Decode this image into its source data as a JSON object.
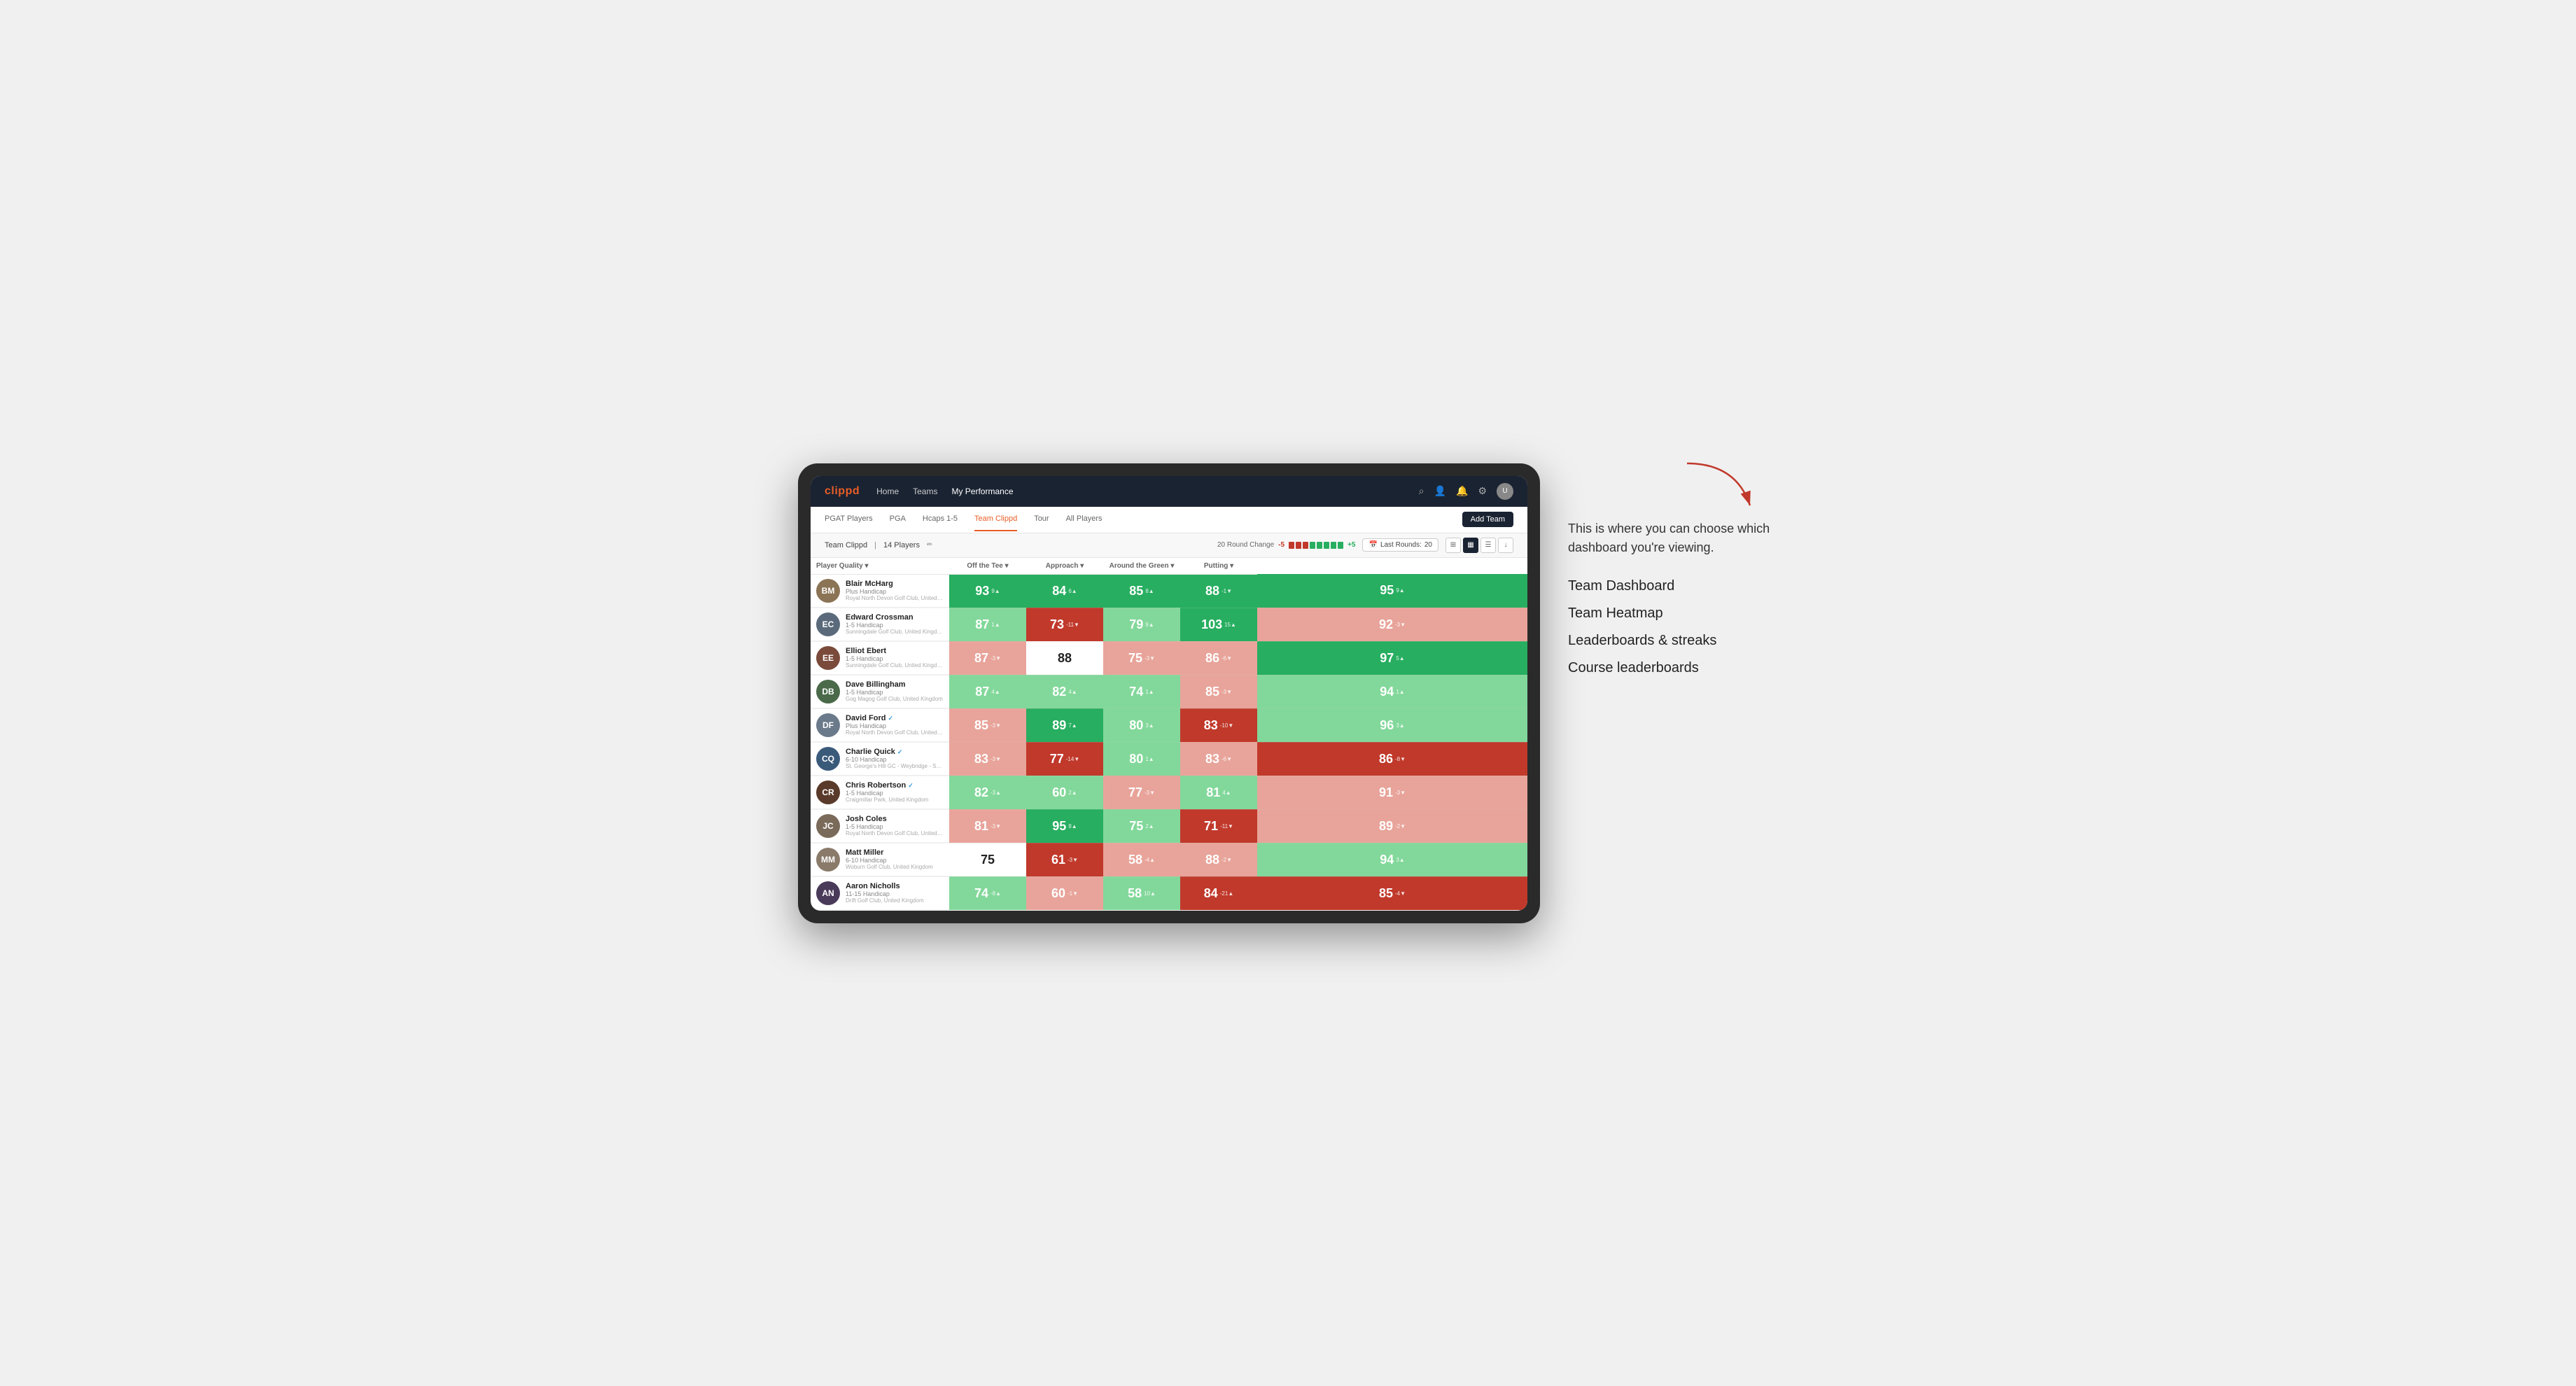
{
  "annotation": {
    "intro_text": "This is where you can choose which dashboard you're viewing.",
    "items": [
      {
        "label": "Team Dashboard"
      },
      {
        "label": "Team Heatmap"
      },
      {
        "label": "Leaderboards & streaks"
      },
      {
        "label": "Course leaderboards"
      }
    ]
  },
  "nav": {
    "logo": "clippd",
    "links": [
      "Home",
      "Teams",
      "My Performance"
    ],
    "active_link": "My Performance"
  },
  "sub_nav": {
    "links": [
      "PGAT Players",
      "PGA",
      "Hcaps 1-5",
      "Team Clippd",
      "Tour",
      "All Players"
    ],
    "active_link": "Team Clippd",
    "add_team_label": "Add Team"
  },
  "team_header": {
    "team_name": "Team Clippd",
    "player_count": "14 Players",
    "round_change_label": "20 Round Change",
    "round_change_neg": "-5",
    "round_change_pos": "+5",
    "last_rounds_label": "Last Rounds:",
    "last_rounds_value": "20"
  },
  "table": {
    "col_headers": [
      "Player Quality ▾",
      "Off the Tee ▾",
      "Approach ▾",
      "Around the Green ▾",
      "Putting ▾"
    ],
    "players": [
      {
        "name": "Blair McHarg",
        "handicap": "Plus Handicap",
        "club": "Royal North Devon Golf Club, United Kingdom",
        "avatar_color": "#8B7355",
        "initials": "BM",
        "scores": [
          {
            "value": "93",
            "change": "9▲",
            "bg": "green-dark"
          },
          {
            "value": "84",
            "change": "6▲",
            "bg": "green-dark"
          },
          {
            "value": "85",
            "change": "8▲",
            "bg": "green-dark"
          },
          {
            "value": "88",
            "change": "-1▼",
            "bg": "green-dark"
          },
          {
            "value": "95",
            "change": "9▲",
            "bg": "green-dark"
          }
        ]
      },
      {
        "name": "Edward Crossman",
        "handicap": "1-5 Handicap",
        "club": "Sunningdale Golf Club, United Kingdom",
        "avatar_color": "#5a6a7a",
        "initials": "EC",
        "scores": [
          {
            "value": "87",
            "change": "1▲",
            "bg": "green-light"
          },
          {
            "value": "73",
            "change": "-11▼",
            "bg": "red-dark"
          },
          {
            "value": "79",
            "change": "9▲",
            "bg": "green-light"
          },
          {
            "value": "103",
            "change": "15▲",
            "bg": "green-dark"
          },
          {
            "value": "92",
            "change": "-3▼",
            "bg": "red-light"
          }
        ]
      },
      {
        "name": "Elliot Ebert",
        "handicap": "1-5 Handicap",
        "club": "Sunningdale Golf Club, United Kingdom",
        "avatar_color": "#7a4a3a",
        "initials": "EE",
        "scores": [
          {
            "value": "87",
            "change": "-3▼",
            "bg": "red-light"
          },
          {
            "value": "88",
            "change": "",
            "bg": "white"
          },
          {
            "value": "75",
            "change": "-3▼",
            "bg": "red-light"
          },
          {
            "value": "86",
            "change": "-6▼",
            "bg": "red-light"
          },
          {
            "value": "97",
            "change": "5▲",
            "bg": "green-dark"
          }
        ]
      },
      {
        "name": "Dave Billingham",
        "handicap": "1-5 Handicap",
        "club": "Gog Magog Golf Club, United Kingdom",
        "avatar_color": "#4a6a4a",
        "initials": "DB",
        "scores": [
          {
            "value": "87",
            "change": "4▲",
            "bg": "green-light"
          },
          {
            "value": "82",
            "change": "4▲",
            "bg": "green-light"
          },
          {
            "value": "74",
            "change": "1▲",
            "bg": "green-light"
          },
          {
            "value": "85",
            "change": "-3▼",
            "bg": "red-light"
          },
          {
            "value": "94",
            "change": "1▲",
            "bg": "green-light"
          }
        ]
      },
      {
        "name": "David Ford",
        "handicap": "Plus Handicap",
        "club": "Royal North Devon Golf Club, United Kingdom",
        "avatar_color": "#6a7a8a",
        "initials": "DF",
        "verified": true,
        "scores": [
          {
            "value": "85",
            "change": "-3▼",
            "bg": "red-light"
          },
          {
            "value": "89",
            "change": "7▲",
            "bg": "green-dark"
          },
          {
            "value": "80",
            "change": "3▲",
            "bg": "green-light"
          },
          {
            "value": "83",
            "change": "-10▼",
            "bg": "red-dark"
          },
          {
            "value": "96",
            "change": "3▲",
            "bg": "green-light"
          }
        ]
      },
      {
        "name": "Charlie Quick",
        "handicap": "6-10 Handicap",
        "club": "St. George's Hill GC - Weybridge - Surrey, Uni...",
        "avatar_color": "#3a5a7a",
        "initials": "CQ",
        "verified": true,
        "scores": [
          {
            "value": "83",
            "change": "-3▼",
            "bg": "red-light"
          },
          {
            "value": "77",
            "change": "-14▼",
            "bg": "red-dark"
          },
          {
            "value": "80",
            "change": "1▲",
            "bg": "green-light"
          },
          {
            "value": "83",
            "change": "-6▼",
            "bg": "red-light"
          },
          {
            "value": "86",
            "change": "-8▼",
            "bg": "red-dark"
          }
        ]
      },
      {
        "name": "Chris Robertson",
        "handicap": "1-5 Handicap",
        "club": "Craigmillar Park, United Kingdom",
        "avatar_color": "#5a3a2a",
        "initials": "CR",
        "verified": true,
        "scores": [
          {
            "value": "82",
            "change": "-3▲",
            "bg": "green-light"
          },
          {
            "value": "60",
            "change": "2▲",
            "bg": "green-light"
          },
          {
            "value": "77",
            "change": "-3▼",
            "bg": "red-light"
          },
          {
            "value": "81",
            "change": "4▲",
            "bg": "green-light"
          },
          {
            "value": "91",
            "change": "-3▼",
            "bg": "red-light"
          }
        ]
      },
      {
        "name": "Josh Coles",
        "handicap": "1-5 Handicap",
        "club": "Royal North Devon Golf Club, United Kingdom",
        "avatar_color": "#7a6a5a",
        "initials": "JC",
        "scores": [
          {
            "value": "81",
            "change": "-3▼",
            "bg": "red-light"
          },
          {
            "value": "95",
            "change": "8▲",
            "bg": "green-dark"
          },
          {
            "value": "75",
            "change": "2▲",
            "bg": "green-light"
          },
          {
            "value": "71",
            "change": "-11▼",
            "bg": "red-dark"
          },
          {
            "value": "89",
            "change": "-2▼",
            "bg": "red-light"
          }
        ]
      },
      {
        "name": "Matt Miller",
        "handicap": "6-10 Handicap",
        "club": "Woburn Golf Club, United Kingdom",
        "avatar_color": "#8a7a6a",
        "initials": "MM",
        "scores": [
          {
            "value": "75",
            "change": "",
            "bg": "white"
          },
          {
            "value": "61",
            "change": "-3▼",
            "bg": "red-dark"
          },
          {
            "value": "58",
            "change": "-4▲",
            "bg": "red-light"
          },
          {
            "value": "88",
            "change": "-2▼",
            "bg": "red-light"
          },
          {
            "value": "94",
            "change": "3▲",
            "bg": "green-light"
          }
        ]
      },
      {
        "name": "Aaron Nicholls",
        "handicap": "11-15 Handicap",
        "club": "Drift Golf Club, United Kingdom",
        "avatar_color": "#4a3a5a",
        "initials": "AN",
        "scores": [
          {
            "value": "74",
            "change": "-8▲",
            "bg": "green-light"
          },
          {
            "value": "60",
            "change": "-1▼",
            "bg": "red-light"
          },
          {
            "value": "58",
            "change": "10▲",
            "bg": "green-light"
          },
          {
            "value": "84",
            "change": "-21▲",
            "bg": "red-dark"
          },
          {
            "value": "85",
            "change": "-4▼",
            "bg": "red-dark"
          }
        ]
      }
    ]
  },
  "colors": {
    "nav_bg": "#1a2332",
    "logo_color": "#e85d26",
    "active_tab_color": "#e85d26",
    "green_dark": "#27ae60",
    "green_light": "#82d89a",
    "red_dark": "#c0392b",
    "red_light": "#e8a49a"
  }
}
